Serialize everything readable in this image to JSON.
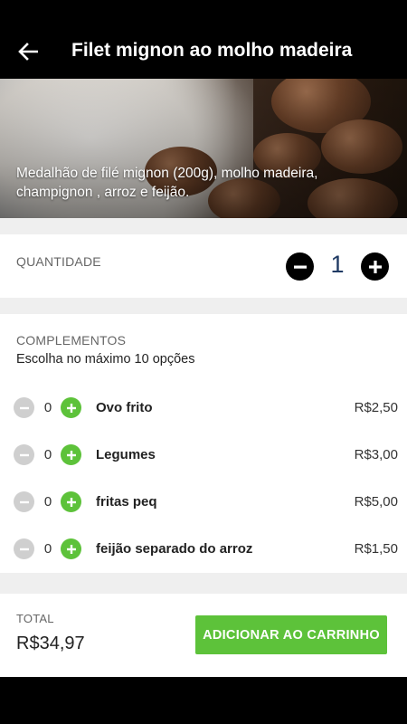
{
  "header": {
    "title": "Filet mignon ao molho madeira",
    "back_icon": "arrow-left-icon"
  },
  "hero": {
    "description": "Medalhão de filé mignon (200g), molho madeira, champignon , arroz e feijão."
  },
  "quantity": {
    "label": "QUANTIDADE",
    "value": "1"
  },
  "complements": {
    "title": "COMPLEMENTOS",
    "subtitle": "Escolha no máximo 10 opções",
    "options": [
      {
        "name": "Ovo frito",
        "count": "0",
        "price": "R$2,50"
      },
      {
        "name": "Legumes",
        "count": "0",
        "price": "R$3,00"
      },
      {
        "name": "fritas peq",
        "count": "0",
        "price": "R$5,00"
      },
      {
        "name": "feijão separado do arroz",
        "count": "0",
        "price": "R$1,50"
      }
    ]
  },
  "footer": {
    "total_label": "TOTAL",
    "total_value": "R$34,97",
    "add_button_label": "ADICIONAR AO CARRINHO"
  },
  "colors": {
    "accent_green": "#5dc23a",
    "quantity_text": "#1f3a63",
    "minus_disabled": "#cfcfcf"
  }
}
